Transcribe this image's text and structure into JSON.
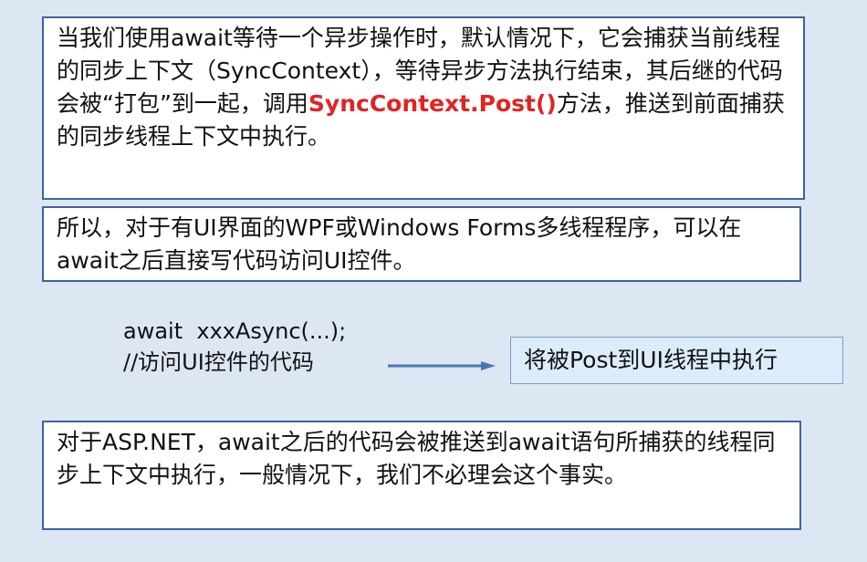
{
  "box1": {
    "text_before": "当我们使用await等待一个异步操作时，默认情况下，它会捕获当前线程的同步上下文（SyncContext），等待异步方法执行结束，其后继的代码会被“打包”到一起，调用",
    "highlight": "SyncContext.Post()",
    "text_after": "方法，推送到前面捕获的同步线程上下文中执行。",
    "highlight_color": "#e32222"
  },
  "box2": {
    "text": "所以，对于有UI界面的WPF或Windows Forms多线程程序，可以在await之后直接写代码访问UI控件。"
  },
  "code": {
    "line1": "await  xxxAsync(...);",
    "line2": "//访问UI控件的代码"
  },
  "post_box": {
    "text": "将被Post到UI线程中执行"
  },
  "box3": {
    "text": "对于ASP.NET，await之后的代码会被推送到await语句所捕获的线程同步上下文中执行，一般情况下，我们不必理会这个事实。"
  },
  "colors": {
    "background": "#dde7f3",
    "border": "#3a64a6",
    "arrow": "#4a76b8",
    "post_box_fill": "#dcecfb"
  }
}
